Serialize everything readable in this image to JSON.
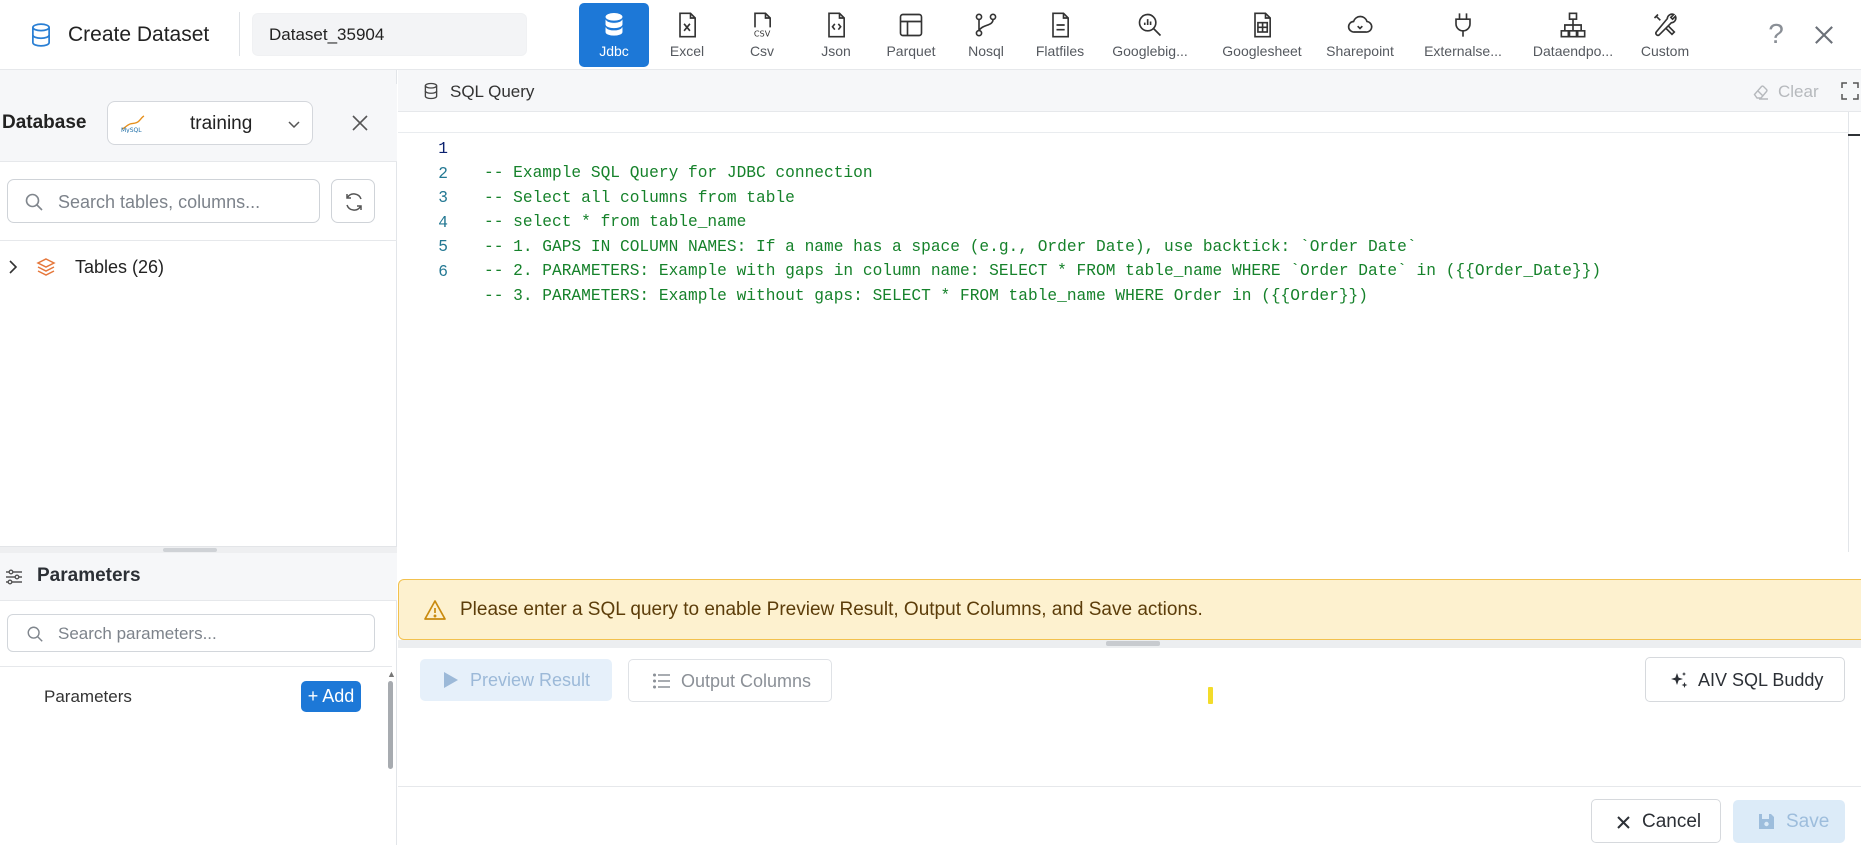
{
  "header": {
    "title": "Create Dataset",
    "dataset_name": "Dataset_35904",
    "source_types": [
      {
        "label": "Jdbc",
        "icon": "database-icon",
        "active": true
      },
      {
        "label": "Excel",
        "icon": "excel-file-icon",
        "active": false
      },
      {
        "label": "Csv",
        "icon": "csv-file-icon",
        "active": false
      },
      {
        "label": "Json",
        "icon": "json-file-icon",
        "active": false
      },
      {
        "label": "Parquet",
        "icon": "parquet-layout-icon",
        "active": false
      },
      {
        "label": "Nosql",
        "icon": "branch-icon",
        "active": false
      },
      {
        "label": "Flatfiles",
        "icon": "document-icon",
        "active": false
      },
      {
        "label": "Googlebig...",
        "icon": "search-chart-icon",
        "active": false
      },
      {
        "label": "Googlesheet",
        "icon": "spreadsheet-icon",
        "active": false
      },
      {
        "label": "Sharepoint",
        "icon": "cloud-icon",
        "active": false
      },
      {
        "label": "Externalse...",
        "icon": "plug-icon",
        "active": false
      },
      {
        "label": "Dataendpo...",
        "icon": "network-icon",
        "active": false
      },
      {
        "label": "Custom",
        "icon": "tools-icon",
        "active": false
      }
    ],
    "help_label": "?"
  },
  "database_panel": {
    "label": "Database",
    "selected": "training",
    "search_placeholder": "Search tables, columns...",
    "tables_label": "Tables (26)"
  },
  "parameters_panel": {
    "title": "Parameters",
    "search_placeholder": "Search parameters...",
    "list_label": "Parameters",
    "add_label": "+ Add"
  },
  "editor": {
    "title": "SQL Query",
    "clear_label": "Clear",
    "lines": [
      {
        "no": "1",
        "text": "-- Example SQL Query for JDBC connection"
      },
      {
        "no": "2",
        "text": "-- Select all columns from table"
      },
      {
        "no": "3",
        "text": "-- select * from table_name"
      },
      {
        "no": "4",
        "text": "-- 1. GAPS IN COLUMN NAMES: If a name has a space (e.g., Order Date), use backtick: `Order Date`"
      },
      {
        "no": "5",
        "text": "-- 2. PARAMETERS: Example with gaps in column name: SELECT * FROM table_name WHERE `Order Date` in ({{Order_Date}})"
      },
      {
        "no": "6",
        "text": "-- 3. PARAMETERS: Example without gaps: SELECT * FROM table_name WHERE Order in ({{Order}})"
      }
    ]
  },
  "warning": {
    "text": "Please enter a SQL query to enable Preview Result, Output Columns, and Save actions."
  },
  "actions": {
    "preview": "Preview Result",
    "output_columns": "Output Columns",
    "sql_buddy": "AIV SQL Buddy",
    "cancel": "Cancel",
    "save": "Save"
  },
  "colors": {
    "accent": "#1d78d7",
    "warning_bg": "#fdf1cf",
    "code_comment": "#16822b"
  }
}
